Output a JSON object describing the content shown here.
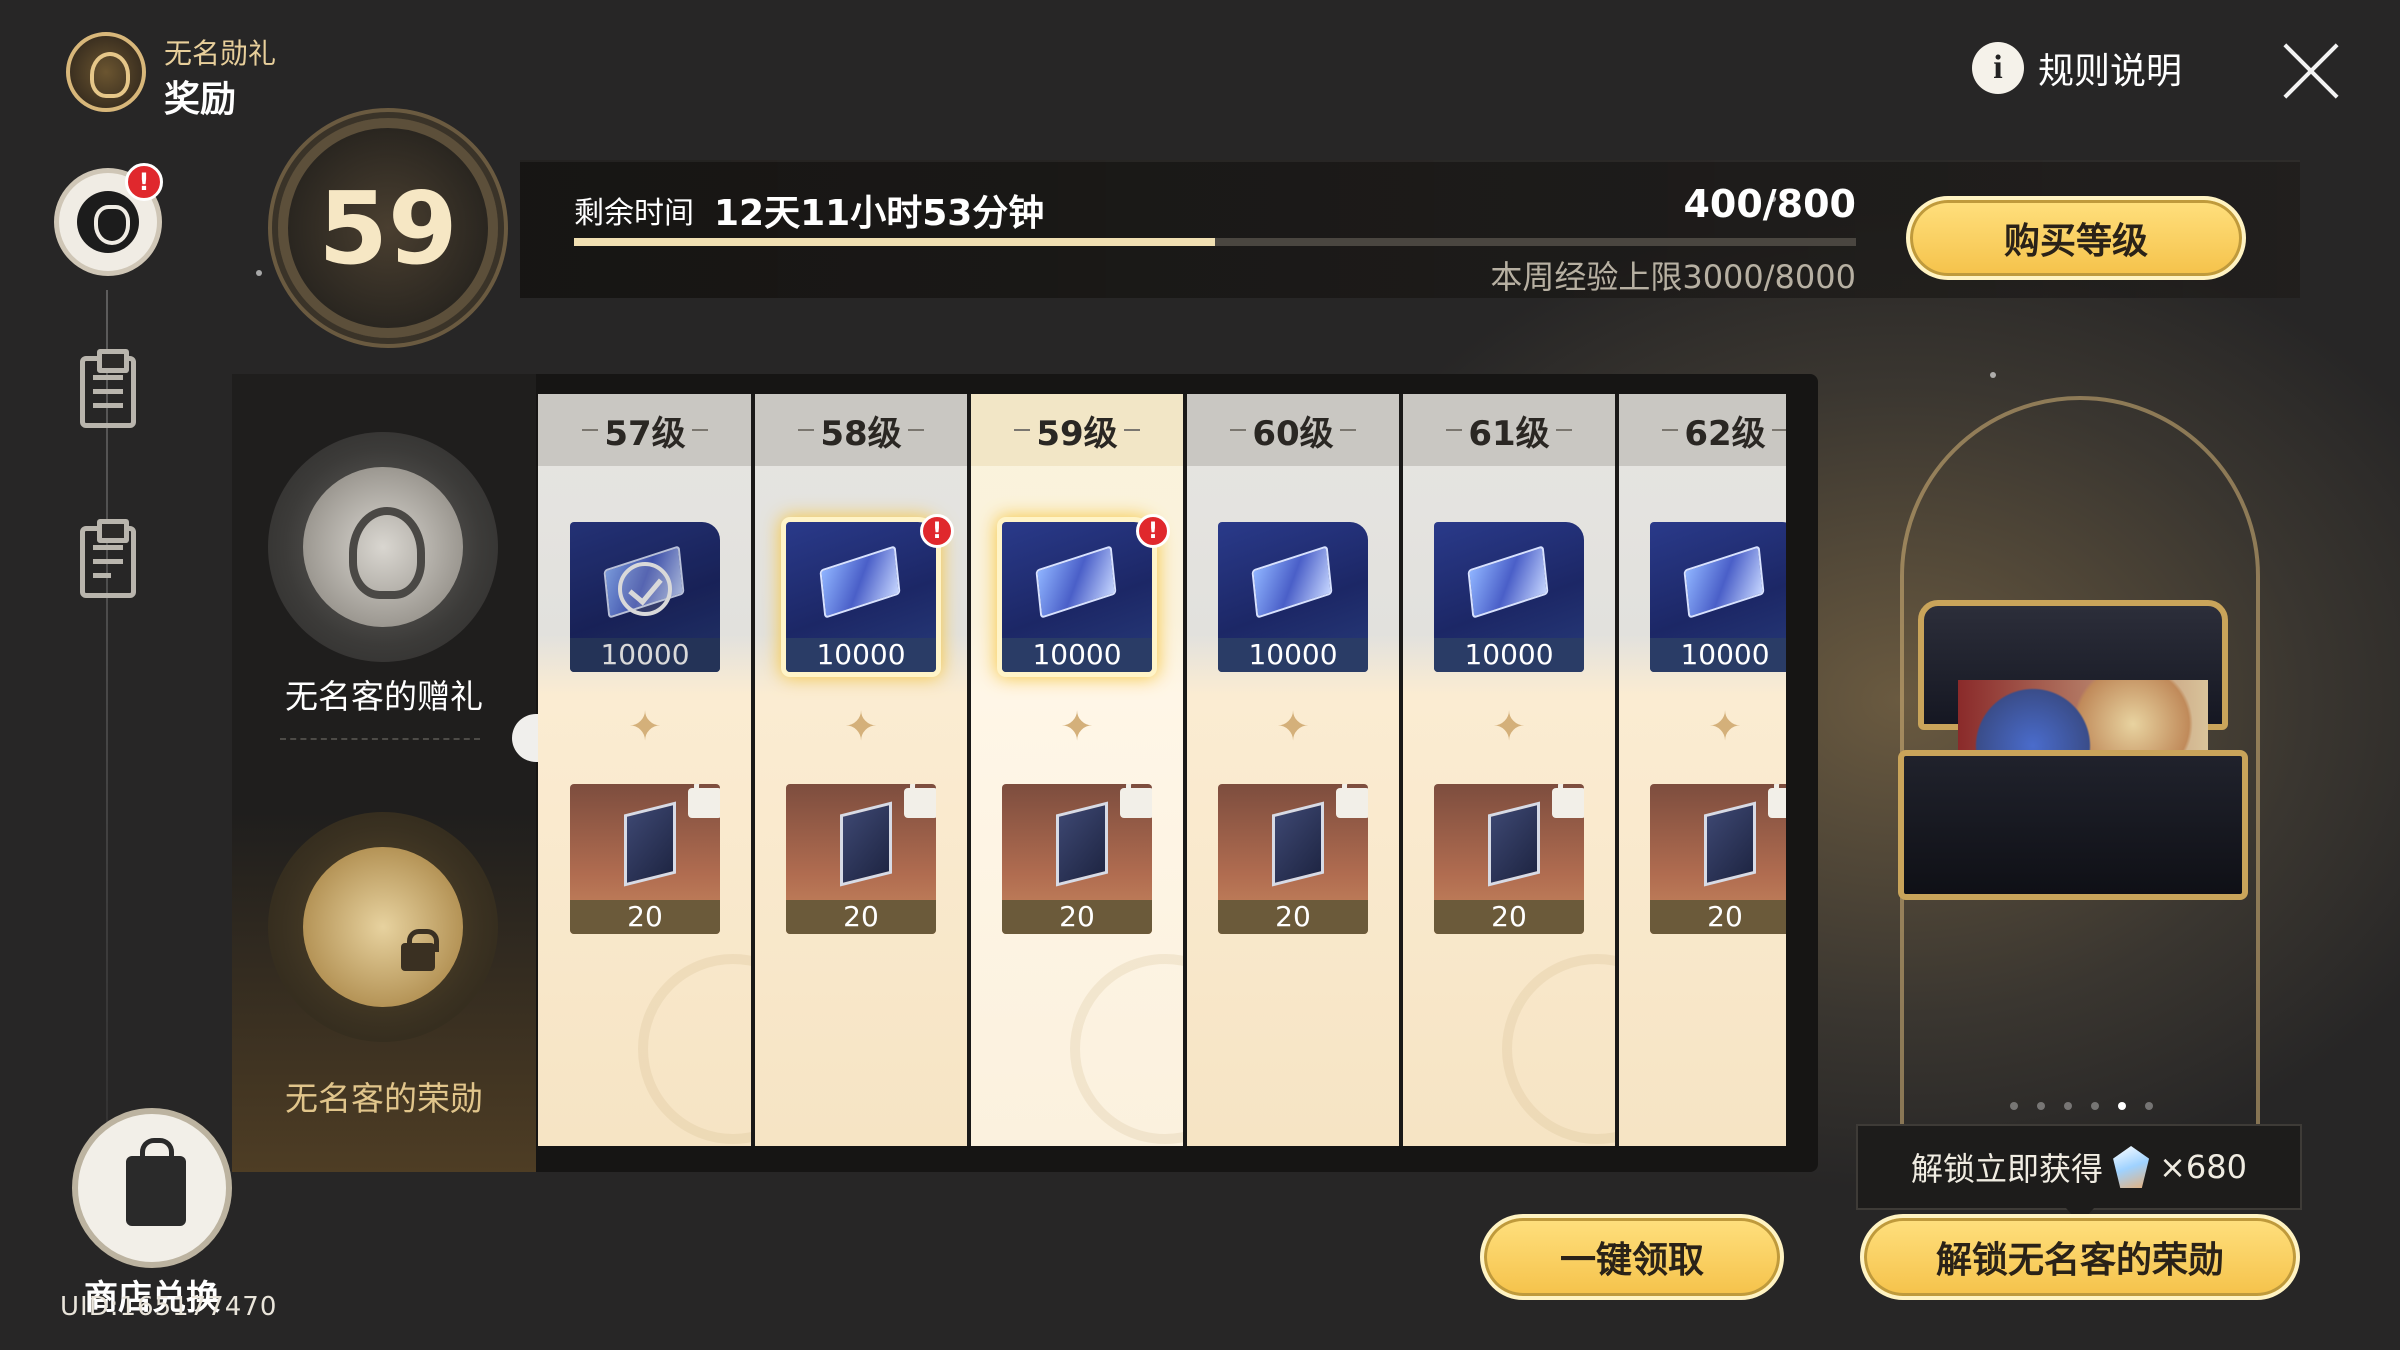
{
  "header": {
    "sub_title": "无名勋礼",
    "title": "奖励",
    "rules_label": "规则说明",
    "info_glyph": "i"
  },
  "nav": {
    "items": [
      {
        "name": "gift-pass-icon",
        "badge": "!"
      },
      {
        "name": "mission-clipboard-icon"
      },
      {
        "name": "log-icon"
      }
    ],
    "shop_label": "商店兑换",
    "uid": "UID:165177470"
  },
  "level": {
    "current": "59",
    "remaining_label": "剩余时间",
    "remaining_value": "12天11小时53分钟",
    "exp_value": "400/800",
    "exp_progress": 0.5,
    "weekly_cap": "本周经验上限3000/8000",
    "buy_label": "购买等级"
  },
  "tracks": {
    "free_label": "无名客的赠礼",
    "premium_label": "无名客的荣勋"
  },
  "rewards": [
    {
      "level": "57级",
      "free_qty": "10000",
      "premium_qty": "20",
      "claimed": true,
      "claimable": false
    },
    {
      "level": "58级",
      "free_qty": "10000",
      "premium_qty": "20",
      "claimed": false,
      "claimable": true,
      "badge": "!"
    },
    {
      "level": "59级",
      "free_qty": "10000",
      "premium_qty": "20",
      "claimed": false,
      "claimable": true,
      "badge": "!",
      "current": true
    },
    {
      "level": "60级",
      "free_qty": "10000",
      "premium_qty": "20",
      "claimed": false,
      "claimable": false
    },
    {
      "level": "61级",
      "free_qty": "10000",
      "premium_qty": "20",
      "claimed": false,
      "claimable": false
    },
    {
      "level": "62级",
      "free_qty": "10000",
      "premium_qty": "20",
      "claimed": false,
      "claimable": false
    }
  ],
  "preview": {
    "page_count": 6,
    "active_page": 5,
    "unlock_tip": "解锁立即获得",
    "unlock_qty": "×680"
  },
  "buttons": {
    "claim_all": "一键领取",
    "unlock": "解锁无名客的荣勋"
  },
  "colors": {
    "gold": "#f5c24a",
    "badge_red": "#e0282d",
    "panel_bg": "#161514"
  }
}
